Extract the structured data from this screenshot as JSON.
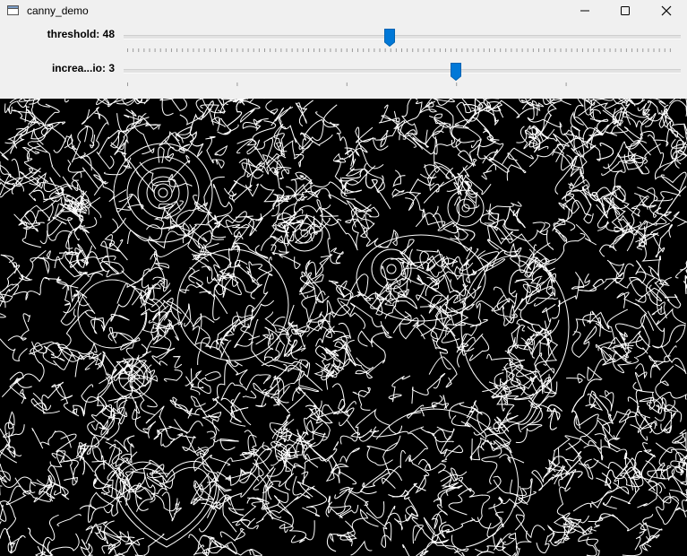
{
  "window": {
    "title": "canny_demo",
    "icon": "app-window-icon",
    "controls": [
      "minimize-icon",
      "maximize-icon",
      "close-icon"
    ]
  },
  "trackbars": [
    {
      "label": "threshold: 48",
      "value": 48,
      "fraction": 0.48
    },
    {
      "label": "increa...io: 3",
      "value": 3,
      "fraction": 0.6
    }
  ],
  "image": {
    "description_colors": {
      "background": "#000000",
      "edges": "#ffffff"
    },
    "accent_color": "#0078d7"
  }
}
